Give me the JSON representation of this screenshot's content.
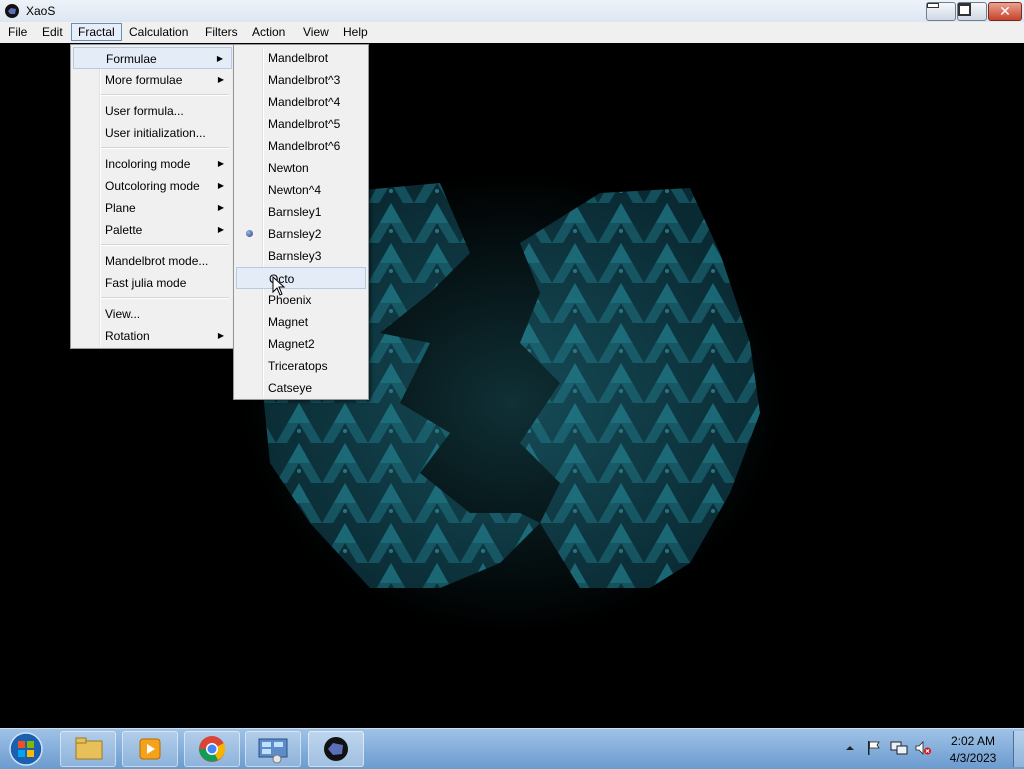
{
  "window": {
    "title": "XaoS"
  },
  "menubar": {
    "items": [
      "File",
      "Edit",
      "Fractal",
      "Calculation",
      "Filters",
      "Action",
      "View",
      "Help"
    ],
    "active": "Fractal"
  },
  "fractal_menu": {
    "items": [
      {
        "label": "Formulae",
        "submenu": true
      },
      {
        "label": "More formulae",
        "submenu": true
      },
      {
        "label": "User formula...",
        "submenu": false
      },
      {
        "label": "User initialization...",
        "submenu": false
      },
      {
        "label": "Incoloring mode",
        "submenu": true
      },
      {
        "label": "Outcoloring mode",
        "submenu": true
      },
      {
        "label": "Plane",
        "submenu": true
      },
      {
        "label": "Palette",
        "submenu": true
      },
      {
        "label": "Mandelbrot mode...",
        "submenu": false
      },
      {
        "label": "Fast julia mode",
        "submenu": false
      },
      {
        "label": "View...",
        "submenu": false
      },
      {
        "label": "Rotation",
        "submenu": true
      }
    ],
    "highlighted": "Formulae"
  },
  "formulae_menu": {
    "items": [
      "Mandelbrot",
      "Mandelbrot^3",
      "Mandelbrot^4",
      "Mandelbrot^5",
      "Mandelbrot^6",
      "Newton",
      "Newton^4",
      "Barnsley1",
      "Barnsley2",
      "Barnsley3",
      "Octo",
      "Phoenix",
      "Magnet",
      "Magnet2",
      "Triceratops",
      "Catseye"
    ],
    "selected": "Barnsley2",
    "hovered": "Octo"
  },
  "colors": {
    "fractal": "#1f6f7c",
    "menu_bg": "#f0f0f0",
    "highlight": "#e3ecf7"
  },
  "taskbar": {
    "apps": [
      "file-explorer-icon",
      "media-player-icon",
      "chrome-icon",
      "control-panel-icon",
      "xaos-icon"
    ],
    "time": "2:02 AM",
    "date": "4/3/2023"
  }
}
